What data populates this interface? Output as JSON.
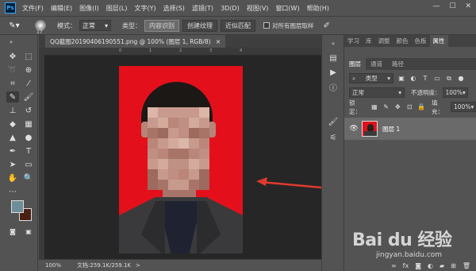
{
  "app": {
    "logo": "Ps"
  },
  "menu": [
    "文件(F)",
    "编辑(E)",
    "图像(I)",
    "图层(L)",
    "文字(Y)",
    "选择(S)",
    "滤镜(T)",
    "3D(D)",
    "视图(V)",
    "窗口(W)",
    "帮助(H)"
  ],
  "window_controls": {
    "minimize": "—",
    "maximize": "☐",
    "close": "✕"
  },
  "options": {
    "brush_size": "17",
    "mode_label": "模式：",
    "mode_value": "正常",
    "type_label": "类型：",
    "type_buttons": [
      "内容识别",
      "创建纹理",
      "近似匹配"
    ],
    "active_type": "内容识别",
    "sample_all_label": "对所有图层取样"
  },
  "document": {
    "tab_title": "QQ截图20190406190551.png @ 100% (图层 1, RGB/8)",
    "close": "×"
  },
  "ruler_ticks": [
    "0",
    "1",
    "2",
    "3",
    "4",
    "5",
    "6",
    "7",
    "8"
  ],
  "status": {
    "zoom": "100%",
    "doc_info": "文档:259.1K/259.1K",
    "caret": ">"
  },
  "panels": {
    "top_tabs": [
      "学习",
      "库",
      "调整",
      "颜色",
      "色板",
      "属性"
    ],
    "active_top_tab": "属性",
    "layer_tabs": [
      "图层",
      "通道",
      "路径"
    ],
    "active_layer_tab": "图层",
    "filter_label": "类型",
    "blend_mode": "正常",
    "opacity_label": "不透明度：",
    "opacity_value": "100%",
    "lock_label": "锁定：",
    "fill_label": "填充：",
    "fill_value": "100%",
    "layers": [
      {
        "name": "图层 1",
        "visible": true
      }
    ],
    "footer_icons": [
      "link-icon",
      "fx-icon",
      "mask-icon",
      "adjustment-icon",
      "group-icon",
      "new-layer-icon",
      "trash-icon"
    ]
  },
  "watermark": {
    "brand": "Bai du 经验",
    "url": "jingyan.baidu.com"
  },
  "colors": {
    "foreground": "#6e8e99",
    "background": "#4a2012",
    "photo_bg": "#e3101c",
    "arrow": "#e03a2e"
  }
}
